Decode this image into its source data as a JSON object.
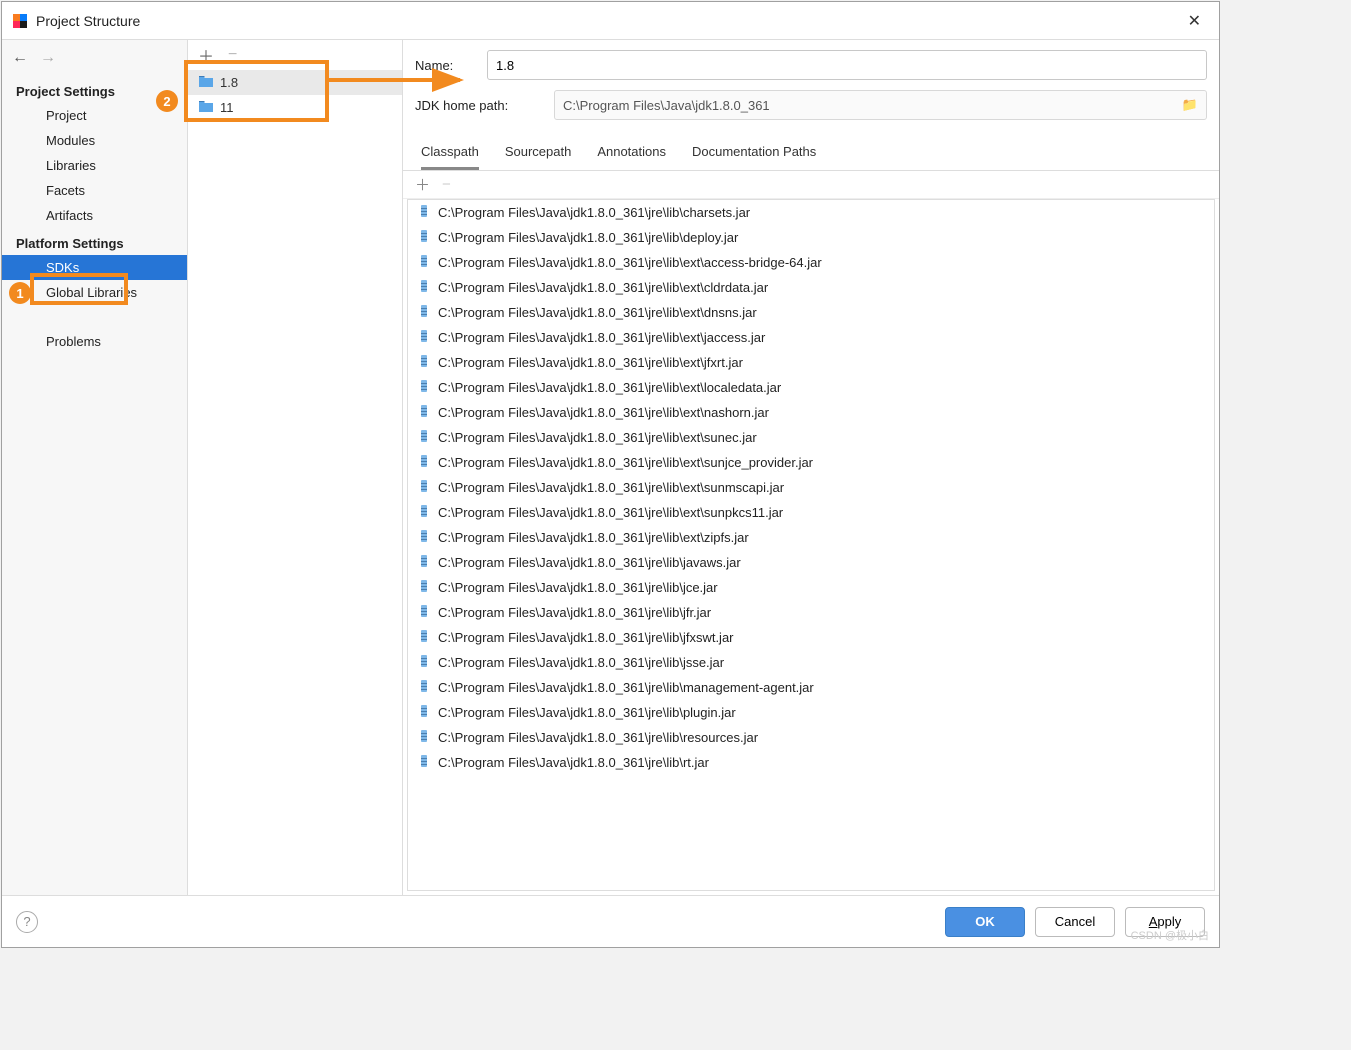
{
  "window": {
    "title": "Project Structure"
  },
  "nav": {
    "section1": "Project Settings",
    "items1": [
      {
        "label": "Project"
      },
      {
        "label": "Modules"
      },
      {
        "label": "Libraries"
      },
      {
        "label": "Facets"
      },
      {
        "label": "Artifacts"
      }
    ],
    "section2": "Platform Settings",
    "items2": [
      {
        "label": "SDKs",
        "selected": true
      },
      {
        "label": "Global Libraries"
      }
    ],
    "section3_item": "Problems"
  },
  "sdks": [
    {
      "label": "1.8",
      "selected": true
    },
    {
      "label": "11"
    }
  ],
  "form": {
    "name_label": "Name:",
    "name_value": "1.8",
    "path_label": "JDK home path:",
    "path_value": "C:\\Program Files\\Java\\jdk1.8.0_361"
  },
  "tabs": [
    {
      "label": "Classpath",
      "active": true
    },
    {
      "label": "Sourcepath"
    },
    {
      "label": "Annotations"
    },
    {
      "label": "Documentation Paths"
    }
  ],
  "classpath": [
    "C:\\Program Files\\Java\\jdk1.8.0_361\\jre\\lib\\charsets.jar",
    "C:\\Program Files\\Java\\jdk1.8.0_361\\jre\\lib\\deploy.jar",
    "C:\\Program Files\\Java\\jdk1.8.0_361\\jre\\lib\\ext\\access-bridge-64.jar",
    "C:\\Program Files\\Java\\jdk1.8.0_361\\jre\\lib\\ext\\cldrdata.jar",
    "C:\\Program Files\\Java\\jdk1.8.0_361\\jre\\lib\\ext\\dnsns.jar",
    "C:\\Program Files\\Java\\jdk1.8.0_361\\jre\\lib\\ext\\jaccess.jar",
    "C:\\Program Files\\Java\\jdk1.8.0_361\\jre\\lib\\ext\\jfxrt.jar",
    "C:\\Program Files\\Java\\jdk1.8.0_361\\jre\\lib\\ext\\localedata.jar",
    "C:\\Program Files\\Java\\jdk1.8.0_361\\jre\\lib\\ext\\nashorn.jar",
    "C:\\Program Files\\Java\\jdk1.8.0_361\\jre\\lib\\ext\\sunec.jar",
    "C:\\Program Files\\Java\\jdk1.8.0_361\\jre\\lib\\ext\\sunjce_provider.jar",
    "C:\\Program Files\\Java\\jdk1.8.0_361\\jre\\lib\\ext\\sunmscapi.jar",
    "C:\\Program Files\\Java\\jdk1.8.0_361\\jre\\lib\\ext\\sunpkcs11.jar",
    "C:\\Program Files\\Java\\jdk1.8.0_361\\jre\\lib\\ext\\zipfs.jar",
    "C:\\Program Files\\Java\\jdk1.8.0_361\\jre\\lib\\javaws.jar",
    "C:\\Program Files\\Java\\jdk1.8.0_361\\jre\\lib\\jce.jar",
    "C:\\Program Files\\Java\\jdk1.8.0_361\\jre\\lib\\jfr.jar",
    "C:\\Program Files\\Java\\jdk1.8.0_361\\jre\\lib\\jfxswt.jar",
    "C:\\Program Files\\Java\\jdk1.8.0_361\\jre\\lib\\jsse.jar",
    "C:\\Program Files\\Java\\jdk1.8.0_361\\jre\\lib\\management-agent.jar",
    "C:\\Program Files\\Java\\jdk1.8.0_361\\jre\\lib\\plugin.jar",
    "C:\\Program Files\\Java\\jdk1.8.0_361\\jre\\lib\\resources.jar",
    "C:\\Program Files\\Java\\jdk1.8.0_361\\jre\\lib\\rt.jar"
  ],
  "footer": {
    "ok": "OK",
    "cancel": "Cancel",
    "apply": "Apply"
  },
  "annotations": {
    "marker1": "1",
    "marker2": "2"
  },
  "watermark": "CSDN @极小白"
}
